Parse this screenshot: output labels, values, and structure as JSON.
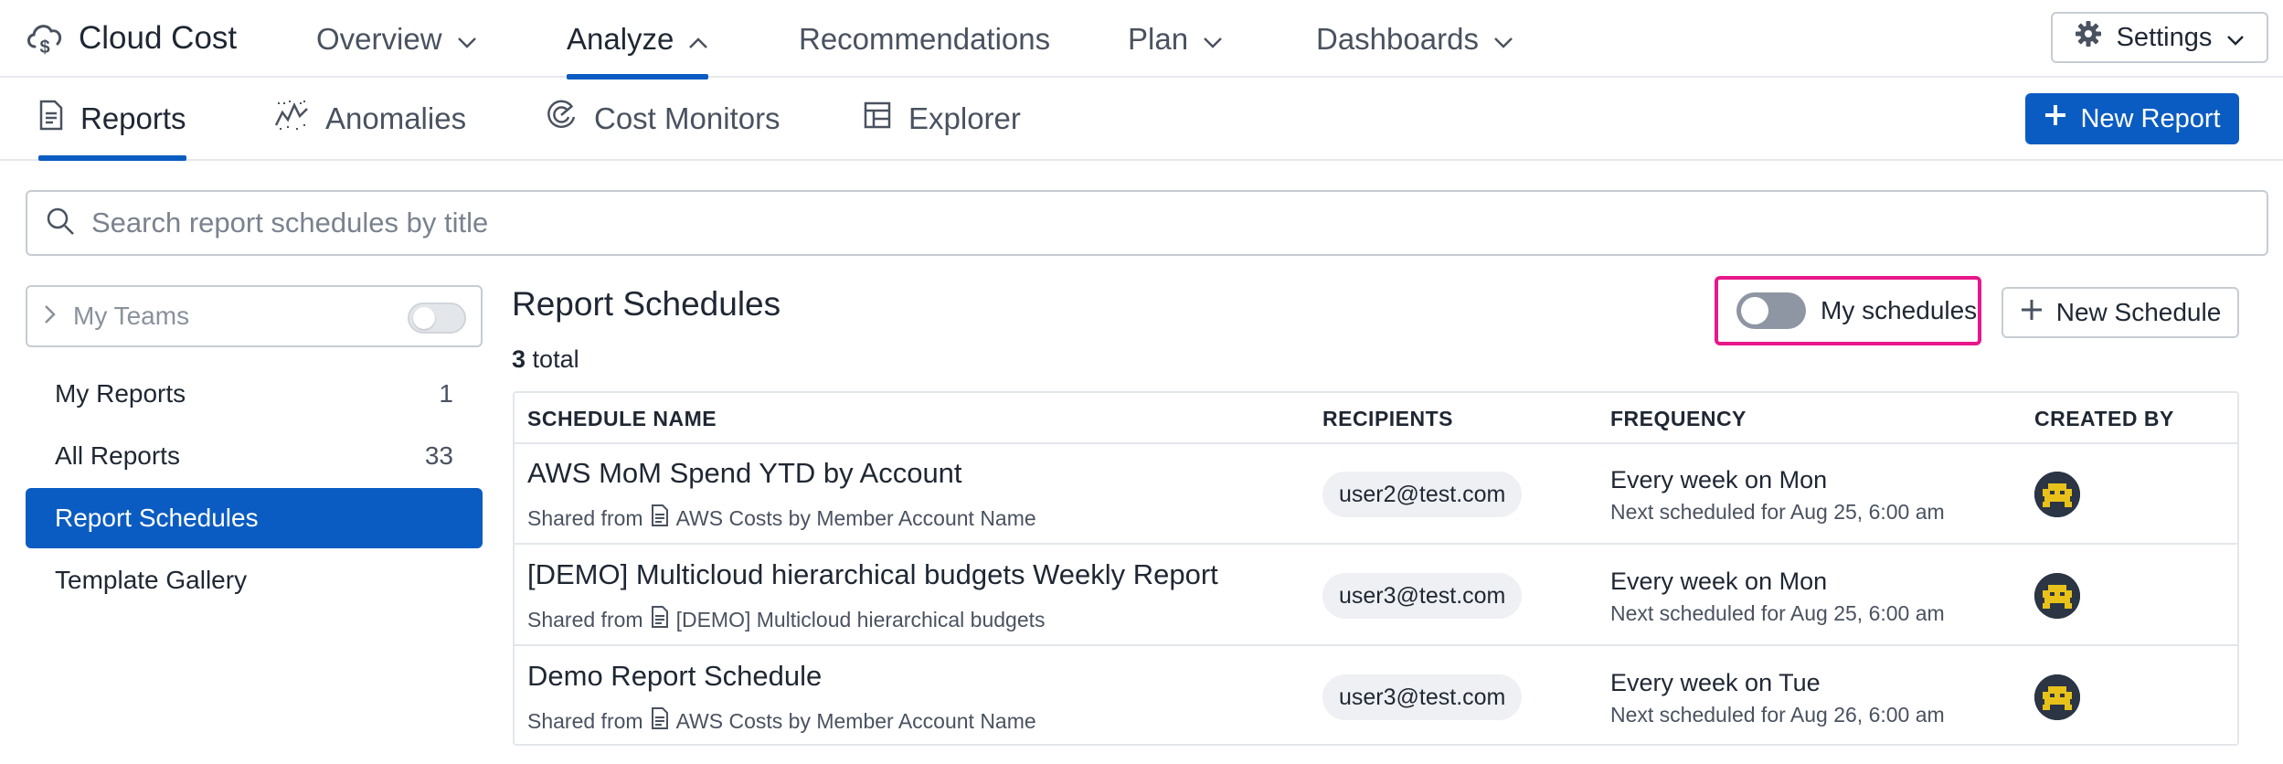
{
  "app": {
    "title": "Cloud Cost"
  },
  "topnav": {
    "items": [
      {
        "label": "Overview",
        "has_chevron": true,
        "chevron": "down",
        "active": false
      },
      {
        "label": "Analyze",
        "has_chevron": true,
        "chevron": "up",
        "active": true
      },
      {
        "label": "Recommendations",
        "has_chevron": false,
        "active": false
      },
      {
        "label": "Plan",
        "has_chevron": true,
        "chevron": "down",
        "active": false
      },
      {
        "label": "Dashboards",
        "has_chevron": true,
        "chevron": "down",
        "active": false
      }
    ],
    "settings_label": "Settings"
  },
  "subnav": {
    "items": [
      {
        "label": "Reports",
        "icon": "document-icon",
        "active": true
      },
      {
        "label": "Anomalies",
        "icon": "anomaly-chart-icon",
        "active": false
      },
      {
        "label": "Cost Monitors",
        "icon": "monitor-gauge-icon",
        "active": false
      },
      {
        "label": "Explorer",
        "icon": "table-grid-icon",
        "active": false
      }
    ],
    "new_report_label": "New Report"
  },
  "search": {
    "placeholder": "Search report schedules by title",
    "value": ""
  },
  "sidebar": {
    "teams_label": "My Teams",
    "items": [
      {
        "label": "My Reports",
        "count": "1",
        "active": false
      },
      {
        "label": "All Reports",
        "count": "33",
        "active": false
      },
      {
        "label": "Report Schedules",
        "count": "",
        "active": true
      },
      {
        "label": "Template Gallery",
        "count": "",
        "active": false
      }
    ]
  },
  "main": {
    "title": "Report Schedules",
    "total_count": "3",
    "total_suffix": "total",
    "my_schedules_label": "My schedules",
    "new_schedule_label": "New Schedule",
    "columns": [
      "SCHEDULE NAME",
      "RECIPIENTS",
      "FREQUENCY",
      "CREATED BY"
    ],
    "rows": [
      {
        "name": "AWS MoM Spend YTD by Account",
        "shared_prefix": "Shared from",
        "shared_report": "AWS Costs by Member Account Name",
        "recipient": "user2@test.com",
        "frequency": "Every week on Mon",
        "next": "Next scheduled for Aug 25, 6:00 am"
      },
      {
        "name": "[DEMO] Multicloud hierarchical budgets Weekly Report",
        "shared_prefix": "Shared from",
        "shared_report": "[DEMO] Multicloud hierarchical budgets",
        "recipient": "user3@test.com",
        "frequency": "Every week on Mon",
        "next": "Next scheduled for Aug 25, 6:00 am"
      },
      {
        "name": "Demo Report Schedule",
        "shared_prefix": "Shared from",
        "shared_report": "AWS Costs by Member Account Name",
        "recipient": "user3@test.com",
        "frequency": "Every week on Tue",
        "next": "Next scheduled for Aug 26, 6:00 am"
      }
    ]
  },
  "colors": {
    "accent": "#0b5cc2",
    "highlight": "#e8178a",
    "avatar_bg": "#2b3544",
    "avatar_fg": "#e8c21a"
  }
}
